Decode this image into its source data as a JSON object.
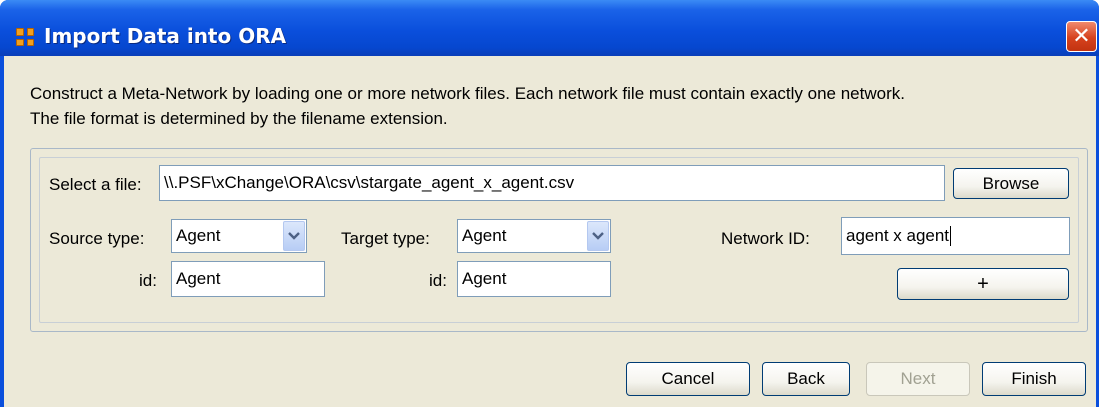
{
  "window": {
    "title": "Import Data into ORA",
    "close_symbol": "✕"
  },
  "intro": {
    "line1": "Construct a Meta-Network by loading one or more network files. Each network file must contain exactly one network.",
    "line2": "The file format is determined by the filename extension."
  },
  "file": {
    "label": "Select a file:",
    "value": "\\\\.PSF\\xChange\\ORA\\csv\\stargate_agent_x_agent.csv",
    "browse_label": "Browse"
  },
  "source": {
    "type_label": "Source type:",
    "type_value": "Agent",
    "id_label": "id:",
    "id_value": "Agent"
  },
  "target": {
    "type_label": "Target type:",
    "type_value": "Agent",
    "id_label": "id:",
    "id_value": "Agent"
  },
  "network": {
    "id_label": "Network ID:",
    "id_value": "agent x agent",
    "add_label": "+"
  },
  "footer": {
    "cancel_label": "Cancel",
    "back_label": "Back",
    "next_label": "Next",
    "finish_label": "Finish"
  },
  "colors": {
    "titlebar": "#0a4fdc",
    "client_bg": "#ece9d8",
    "close_button": "#d6421e",
    "field_border": "#7f9db9"
  },
  "icons": {
    "app": "ora-app-icon",
    "close": "close-icon",
    "dropdown": "chevron-down-icon"
  }
}
